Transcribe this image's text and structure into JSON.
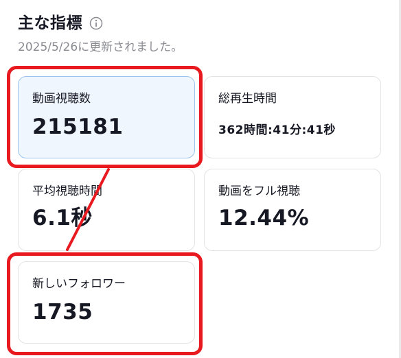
{
  "header": {
    "title": "主な指標",
    "info_icon": "info-circle-icon",
    "updated_text": "2025/5/26に更新されました。"
  },
  "metrics": [
    {
      "label": "動画視聴数",
      "value": "215181"
    },
    {
      "label": "総再生時間",
      "value": "362時間:41分:41秒"
    },
    {
      "label": "平均視聴時間",
      "value": "6.1秒"
    },
    {
      "label": "動画をフル視聴",
      "value": "12.44%"
    },
    {
      "label": "新しいフォロワー",
      "value": "1735"
    }
  ],
  "annotation": {
    "color": "#e8191f"
  },
  "colors": {
    "selected_card_bg": "#f0f6fd",
    "selected_card_border": "#9bc3ee",
    "subtitle": "#8a8b91"
  }
}
